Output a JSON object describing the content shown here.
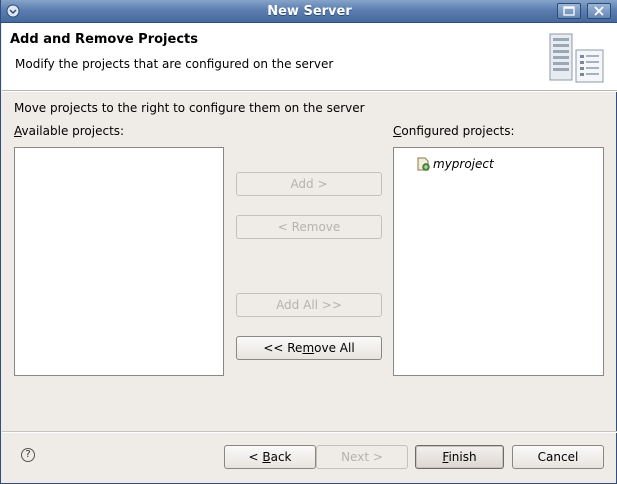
{
  "window": {
    "title": "New Server"
  },
  "banner": {
    "heading": "Add and Remove Projects",
    "description": "Modify the projects that are configured on the server",
    "icon": "server-icon"
  },
  "instruction": "Move projects to the right to configure them on the server",
  "available": {
    "label_mnemonic": "A",
    "label_rest": "vailable projects:",
    "items": []
  },
  "configured": {
    "label_mnemonic": "C",
    "label_rest": "onfigured projects:",
    "items": [
      {
        "name": "myproject",
        "icon": "web-project-icon"
      }
    ]
  },
  "buttons": {
    "add": "Add >",
    "remove": "< Remove",
    "add_all": "Add All >>",
    "remove_all_pre": "<< Re",
    "remove_all_mn": "m",
    "remove_all_post": "ove All",
    "back_pre": "< ",
    "back_mn": "B",
    "back_post": "ack",
    "next": "Next >",
    "finish_mn": "F",
    "finish_post": "inish",
    "cancel": "Cancel"
  },
  "help": {
    "glyph": "?",
    "icon": "help-icon"
  },
  "colors": {
    "titlebar": "#5c7fb0",
    "dialog_bg": "#efebe7",
    "disabled_text": "#b6b2ad"
  }
}
